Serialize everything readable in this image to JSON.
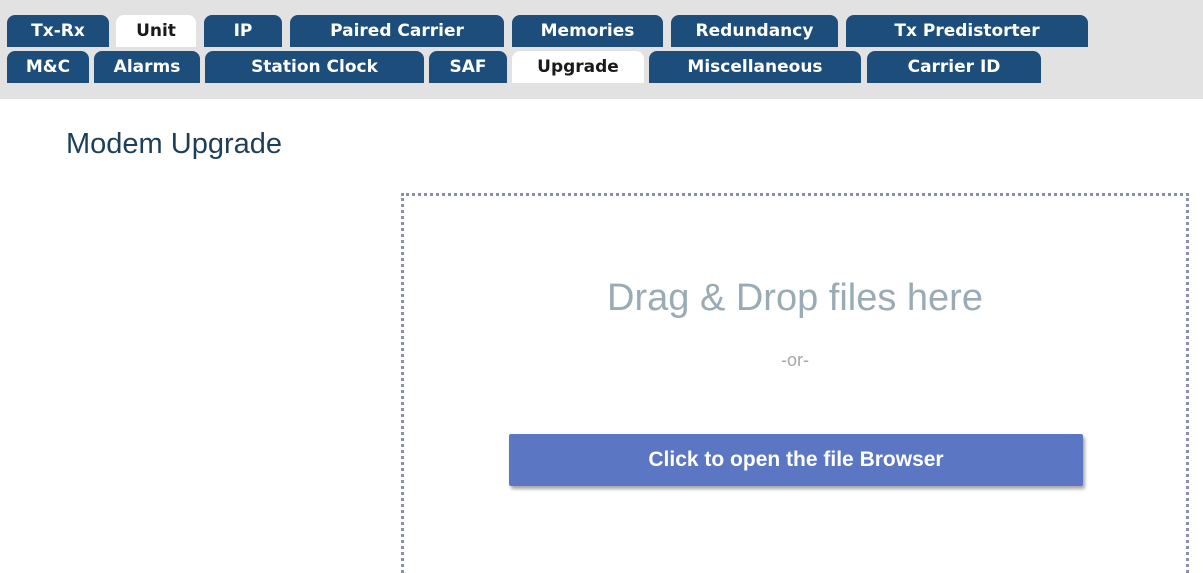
{
  "tabs": {
    "row1": [
      {
        "label": "Tx-Rx",
        "active": false
      },
      {
        "label": "Unit",
        "active": true
      },
      {
        "label": "IP",
        "active": false
      },
      {
        "label": "Paired Carrier",
        "active": false
      },
      {
        "label": "Memories",
        "active": false
      },
      {
        "label": "Redundancy",
        "active": false
      },
      {
        "label": "Tx Predistorter",
        "active": false
      }
    ],
    "row2": [
      {
        "label": "M&C",
        "active": false
      },
      {
        "label": "Alarms",
        "active": false
      },
      {
        "label": "Station Clock",
        "active": false
      },
      {
        "label": "SAF",
        "active": false
      },
      {
        "label": "Upgrade",
        "active": true
      },
      {
        "label": "Miscellaneous",
        "active": false
      },
      {
        "label": "Carrier ID",
        "active": false
      }
    ]
  },
  "page": {
    "title": "Modem Upgrade"
  },
  "upload": {
    "drop_text": "Drag & Drop files here",
    "or_text": "-or-",
    "browse_label": "Click to open the file Browser"
  },
  "colors": {
    "tab_background": "#1d4d7a",
    "tab_active_background": "#ffffff",
    "tab_strip_background": "#e2e2e2",
    "title_color": "#1e3f5a",
    "drop_text_color": "#9aabb6",
    "browse_button_color": "#5b77c4",
    "drop_border_color": "#8a8fb0"
  }
}
